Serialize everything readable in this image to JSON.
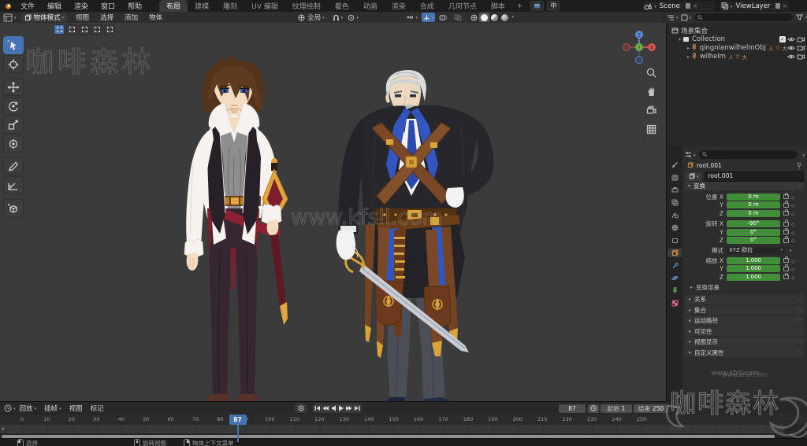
{
  "ui_colors": {
    "accent_blue": "#4772b3",
    "field_green": "#418d3a",
    "gold": "#d9a33c",
    "badge_orange": "#e0955a"
  },
  "topbar": {
    "menus": [
      "文件",
      "编辑",
      "渲染",
      "窗口",
      "帮助"
    ],
    "workspaces": [
      {
        "label": "布局",
        "active": true
      },
      {
        "label": "建模"
      },
      {
        "label": "雕刻"
      },
      {
        "label": "UV 编辑"
      },
      {
        "label": "纹理绘制"
      },
      {
        "label": "着色"
      },
      {
        "label": "动画"
      },
      {
        "label": "渲染"
      },
      {
        "label": "合成"
      },
      {
        "label": "几何节点"
      },
      {
        "label": "脚本"
      }
    ],
    "add_workspace": "+",
    "ime_badge": "中",
    "scene_label": "Scene",
    "viewlayer_label": "ViewLayer"
  },
  "viewport": {
    "mode": "物体模式",
    "menus": [
      "视图",
      "选择",
      "添加",
      "物体"
    ],
    "orientation": "全局",
    "gizmo_axes": {
      "x": "X",
      "y": "Y",
      "z": "Z"
    }
  },
  "outliner": {
    "rows": [
      {
        "label": "场景集合"
      },
      {
        "label": "Collection"
      },
      {
        "label": "qingnianwilhelmObj"
      },
      {
        "label": "wilhelm"
      }
    ],
    "armature_badges": [
      "人",
      "▽",
      "大"
    ]
  },
  "properties": {
    "breadcrumb_object": "root.001",
    "name_field": "root.001",
    "transform_panel": {
      "title": "变换",
      "rows": [
        {
          "label": "位置 X",
          "value": "0 m"
        },
        {
          "label": "Y",
          "value": "0 m"
        },
        {
          "label": "Z",
          "value": "0 m"
        },
        {
          "label": "旋转 X",
          "value": "-90°"
        },
        {
          "label": "Y",
          "value": "0°"
        },
        {
          "label": "Z",
          "value": "0°"
        }
      ],
      "mode_label": "模式",
      "mode_value": "XYZ 欧拉",
      "scale_rows": [
        {
          "label": "缩放 X",
          "value": "1.000"
        },
        {
          "label": "Y",
          "value": "1.000"
        },
        {
          "label": "Z",
          "value": "1.000"
        }
      ]
    },
    "delta_section": "变换增量",
    "sections": [
      "关系",
      "集合",
      "运动路径",
      "可见性",
      "视图显示",
      "自定义属性"
    ]
  },
  "timeline": {
    "menus_drop": [
      "回放",
      "插帧"
    ],
    "menus_plain": [
      "视图",
      "标记"
    ],
    "tick_values": [
      0,
      10,
      20,
      30,
      40,
      50,
      60,
      70,
      80,
      90,
      100,
      110,
      120,
      130,
      140,
      150,
      160,
      170,
      180,
      190,
      200,
      210,
      220,
      230,
      240,
      250
    ],
    "current_frame": 87,
    "frame_display": "87",
    "start_label": "起始",
    "start_value": "1",
    "end_label": "结束",
    "end_value": "250"
  },
  "statusbar": {
    "hints": [
      "选择",
      "旋转视图",
      "物体上下文菜单"
    ]
  },
  "watermarks": {
    "corner_text": "咖啡森林",
    "center_text": "www.kfsll.com",
    "panel_url": "www.kfsll.com",
    "panel_brand": "咖啡森林"
  },
  "icons": [
    "blender-logo",
    "select-box-tool",
    "cursor-tool",
    "move-tool",
    "rotate-tool",
    "scale-tool",
    "transform-tool",
    "annotate-tool",
    "measure-tool",
    "add-cube-tool",
    "magnet-icon",
    "eye-icon",
    "camera-icon",
    "armature-icon",
    "collection-icon",
    "search-icon",
    "funnel-icon",
    "clock-icon",
    "auto-key-icon",
    "mouse-left-icon",
    "mouse-middle-icon",
    "mouse-right-icon"
  ]
}
